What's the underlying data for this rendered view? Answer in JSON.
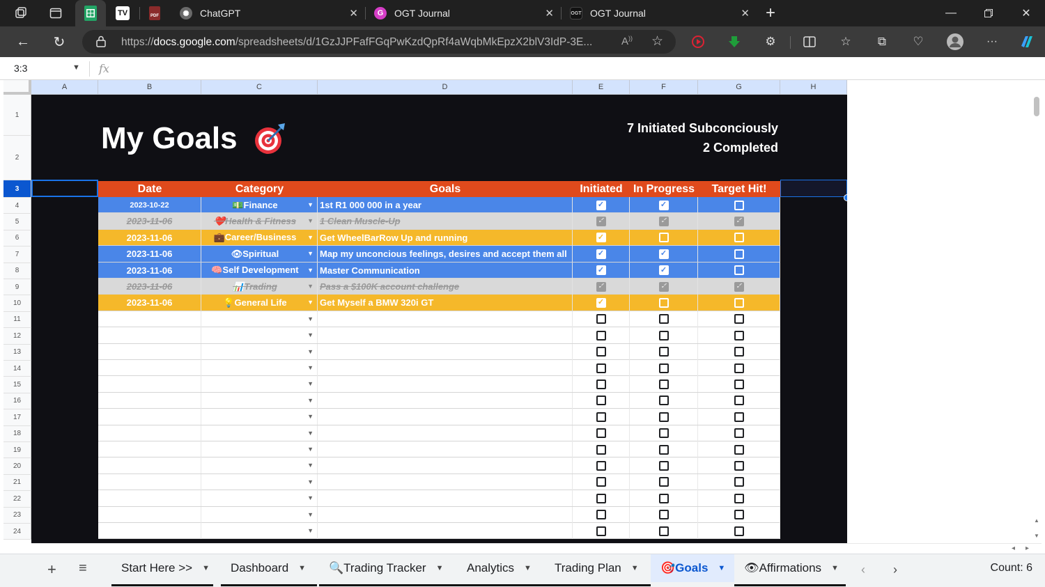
{
  "browser": {
    "tabs": [
      {
        "title": "ChatGPT",
        "favicon": "chatgpt-icon"
      },
      {
        "title": "OGT Journal",
        "favicon": "G"
      },
      {
        "title": "OGT Journal",
        "favicon": "OGT"
      }
    ],
    "url_prefix": "https://",
    "url_domain": "docs.google.com",
    "url_rest": "/spreadsheets/d/1GzJJPFafFGqPwKzdQpRf4aWqbMkEpzX2blV3IdP-3E..."
  },
  "formula_bar": {
    "name_box": "3:3",
    "fx": "fx"
  },
  "columns": [
    "A",
    "B",
    "C",
    "D",
    "E",
    "F",
    "G",
    "H"
  ],
  "rows": [
    "1",
    "2",
    "3",
    "4",
    "5",
    "6",
    "7",
    "8",
    "9",
    "10",
    "11",
    "12",
    "13",
    "14",
    "15",
    "16",
    "17",
    "18",
    "19",
    "20",
    "21",
    "22",
    "23",
    "24"
  ],
  "sheet": {
    "title": "My Goals",
    "summary_line1": "7 Initiated Subconciously",
    "summary_line2": "2 Completed",
    "headers": {
      "date": "Date",
      "category": "Category",
      "goals": "Goals",
      "initiated": "Initiated",
      "in_progress": "In Progress",
      "target_hit": "Target Hit!"
    },
    "goals": [
      {
        "date": "2023-10-22",
        "category": "💵Finance",
        "goal": "1st R1 000 000 in a year",
        "style": "blue",
        "initiated": true,
        "in_progress": true,
        "target_hit": false
      },
      {
        "date": "2023-11-06",
        "category": "❤️Health & Fitness",
        "goal": "1 Clean Muscle-Up",
        "style": "gray",
        "initiated": true,
        "in_progress": true,
        "target_hit": true
      },
      {
        "date": "2023-11-06",
        "category": "💼Career/Business",
        "goal": "Get WheelBarRow Up and running",
        "style": "yellow",
        "initiated": true,
        "in_progress": false,
        "target_hit": false
      },
      {
        "date": "2023-11-06",
        "category": "👁Spiritual",
        "goal": "Map my unconcious feelings, desires and accept them all",
        "style": "blue",
        "initiated": true,
        "in_progress": true,
        "target_hit": false
      },
      {
        "date": "2023-11-06",
        "category": "🧠Self Development",
        "goal": "Master Communication",
        "style": "blue",
        "initiated": true,
        "in_progress": true,
        "target_hit": false
      },
      {
        "date": "2023-11-06",
        "category": "📊Trading",
        "goal": "Pass a $100K account challenge",
        "style": "gray",
        "initiated": true,
        "in_progress": true,
        "target_hit": true
      },
      {
        "date": "2023-11-06",
        "category": "💡General Life",
        "goal": "Get Myself a BMW 320i GT",
        "style": "yellow",
        "initiated": true,
        "in_progress": false,
        "target_hit": false
      }
    ],
    "empty_rows": 14
  },
  "sheet_tabs": [
    {
      "label": "Start Here >>",
      "active": false
    },
    {
      "label": "Dashboard",
      "active": false
    },
    {
      "label": "🔍Trading Tracker",
      "active": false
    },
    {
      "label": "Analytics",
      "active": false
    },
    {
      "label": "Trading Plan",
      "active": false
    },
    {
      "label": "🎯Goals",
      "active": true
    },
    {
      "label": "👁Affirmations",
      "active": false
    }
  ],
  "status": {
    "count": "Count: 6"
  },
  "colors": {
    "header_orange": "#e04a1c",
    "row_blue": "#4a86e8",
    "row_gray": "#d9d9d9",
    "row_yellow": "#f5b82a",
    "sheet_bg": "#0f0f14"
  }
}
